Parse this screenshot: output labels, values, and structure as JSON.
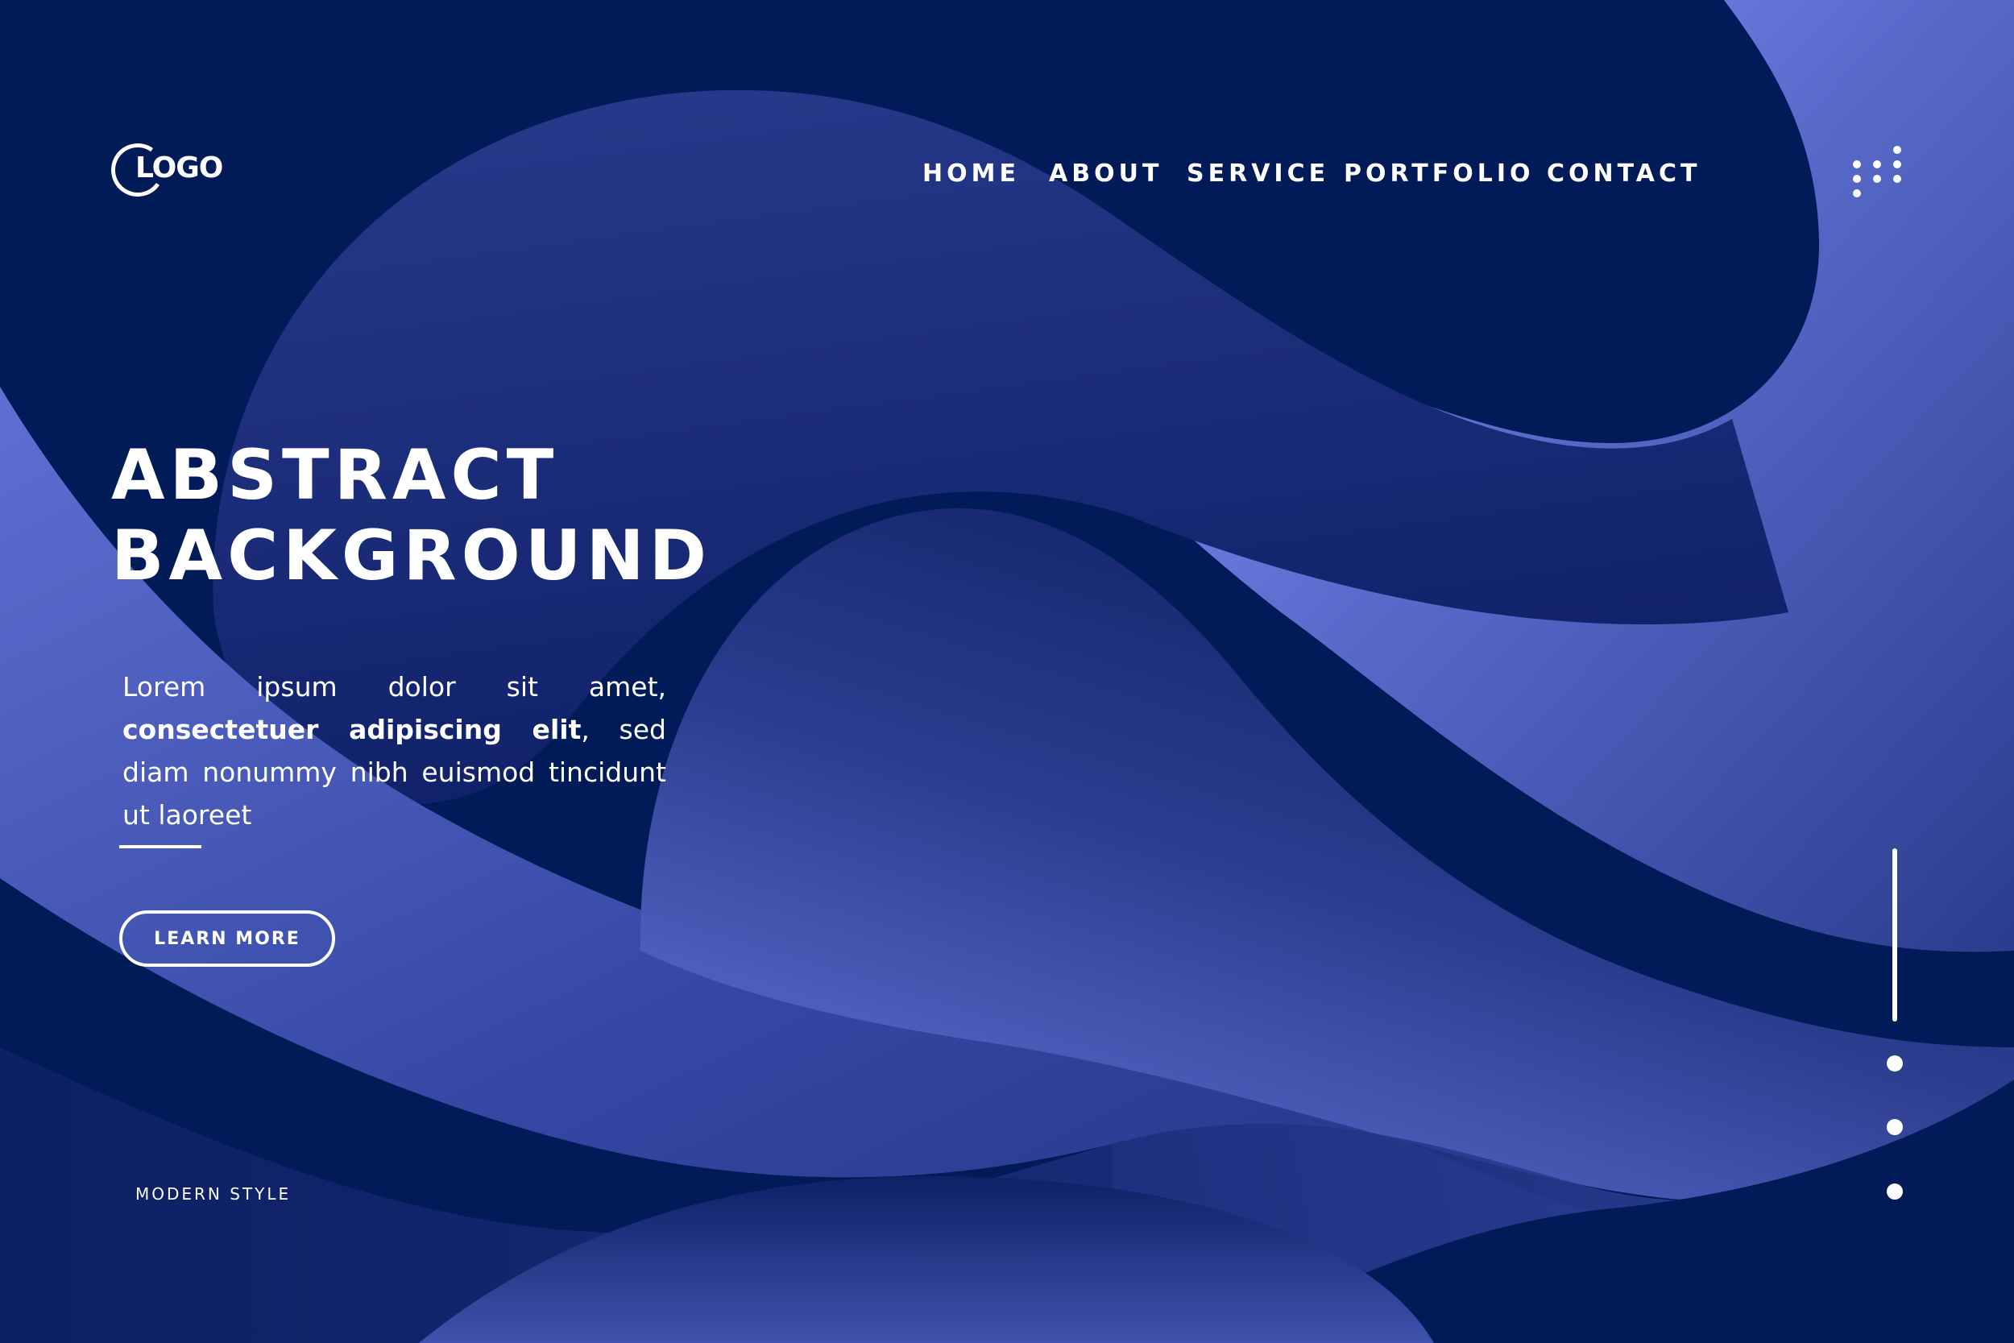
{
  "brand": {
    "logo_text": "LOGO"
  },
  "nav": {
    "items": [
      {
        "label": "HOME"
      },
      {
        "label": "ABOUT"
      },
      {
        "label": "SERVICE"
      },
      {
        "label": "PORTFOLIO"
      },
      {
        "label": "CONTACT"
      }
    ]
  },
  "hero": {
    "title_line1": "ABSTRACT",
    "title_line2": "BACKGROUND",
    "text_part1": "Lorem ipsum dolor sit amet, ",
    "text_bold": "consectetuer adipiscing elit",
    "text_part2": ", sed diam nonummy nibh euismod tincidunt ut laoreet",
    "button_label": "LEARN MORE",
    "tagline": "MODERN STYLE"
  },
  "slider": {
    "dots": 3
  },
  "icons": {
    "logo": "logo-ring-icon",
    "menu": "dots-grid-icon"
  },
  "colors": {
    "background_dark": "#011a58",
    "wave_light": "#7b8af0",
    "wave_mid": "#3a4ea0",
    "text": "#ffffff"
  }
}
